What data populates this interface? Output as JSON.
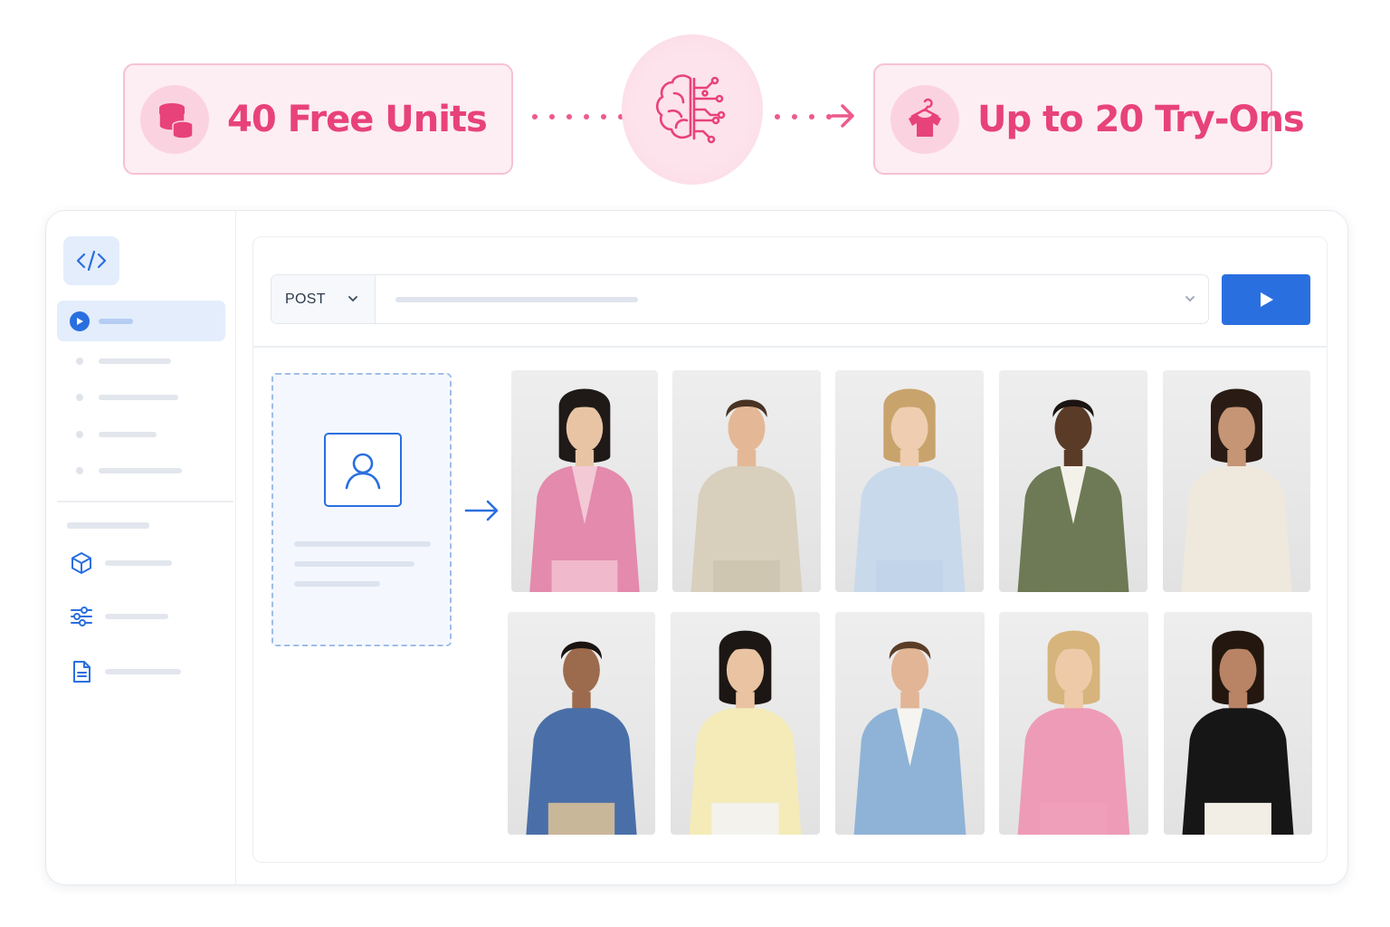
{
  "banner": {
    "free_units_label": "40 Free Units",
    "tryons_label": "Up to 20 Try-Ons",
    "accent_color": "#e8427b",
    "icons": [
      "coins-icon",
      "ai-brain-icon",
      "shirt-hanger-icon"
    ]
  },
  "request": {
    "method": "POST"
  },
  "colors": {
    "primary": "#2a6fe0",
    "pink_accent": "#e8427b"
  },
  "results": [
    {
      "name": "pink-blazer",
      "skin": "#e8c4a4",
      "hair": "#1f1a17",
      "top": "#e48aac",
      "inner": "#f3c9d6",
      "bottom": "#f1b9cc",
      "long_hair": true
    },
    {
      "name": "beige-knit-polo",
      "skin": "#e4b896",
      "hair": "#4a3323",
      "top": "#d8cfbd",
      "inner": "#d8cfbd",
      "bottom": "#cfc6b2",
      "long_hair": false
    },
    {
      "name": "floral-blue-dress",
      "skin": "#efcdb0",
      "hair": "#c9a36c",
      "top": "#c9d9ec",
      "inner": "#c9d9ec",
      "bottom": "#c1d4ea",
      "long_hair": true
    },
    {
      "name": "olive-overshirt",
      "skin": "#5a3b28",
      "hair": "#1b1410",
      "top": "#6d7a55",
      "inner": "#f4f1ea",
      "bottom": "#6d7a55",
      "long_hair": false
    },
    {
      "name": "white-vest",
      "skin": "#c59576",
      "hair": "#2a1c14",
      "top": "#efe9dd",
      "inner": "#efe9dd",
      "bottom": "#efe9dd",
      "long_hair": true
    },
    {
      "name": "blue-sweater",
      "skin": "#9c6a4c",
      "hair": "#1a1411",
      "top": "#4a6fa8",
      "inner": "#4a6fa8",
      "bottom": "#c9b79a",
      "long_hair": false
    },
    {
      "name": "yellow-puff-top",
      "skin": "#e9c3a2",
      "hair": "#1c1714",
      "top": "#f4ebb8",
      "inner": "#f4ebb8",
      "bottom": "#f4f2ec",
      "long_hair": true
    },
    {
      "name": "denim-jacket",
      "skin": "#e2b596",
      "hair": "#5b3d27",
      "top": "#8fb3d6",
      "inner": "#f5f4f0",
      "bottom": "#8fb3d6",
      "long_hair": false
    },
    {
      "name": "pink-slip-dress",
      "skin": "#efcaa8",
      "hair": "#d6b47c",
      "top": "#ee9bb7",
      "inner": "#ee9bb7",
      "bottom": "#ef9fba",
      "long_hair": true
    },
    {
      "name": "black-one-shoulder",
      "skin": "#b98466",
      "hair": "#231710",
      "top": "#161616",
      "inner": "#161616",
      "bottom": "#f2eee6",
      "long_hair": true
    }
  ]
}
